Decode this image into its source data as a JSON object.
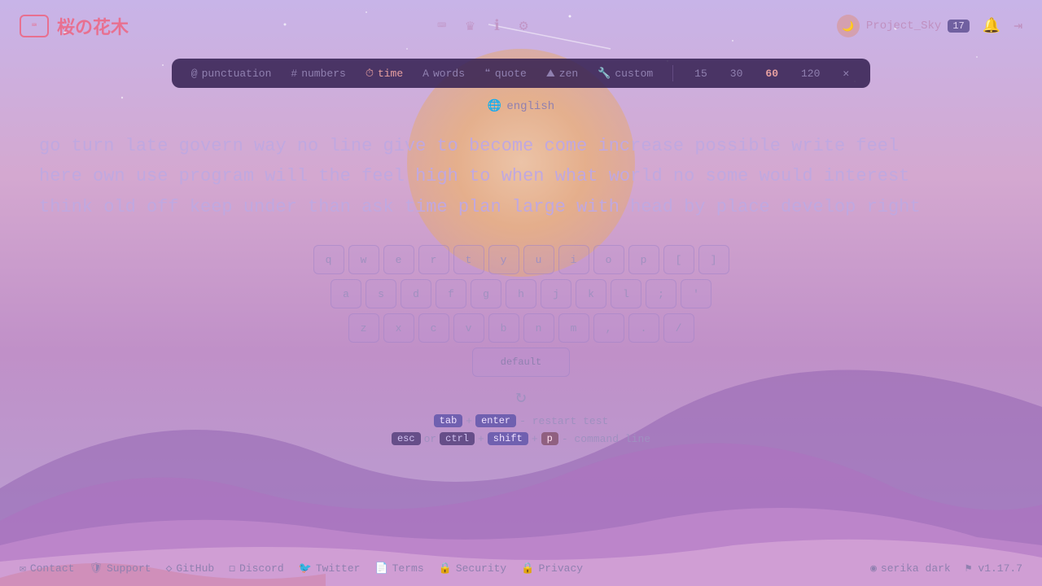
{
  "app": {
    "logo_icon": "⌨",
    "logo_text": "桜の花木",
    "accent_color": "#e87090"
  },
  "header": {
    "nav_icons": [
      "⌨",
      "♛",
      "ℹ",
      "⚙"
    ],
    "user": {
      "name": "Project_Sky",
      "level": "17",
      "avatar_text": "🌙"
    },
    "action_icons": [
      "🔔",
      "→"
    ]
  },
  "toolbar": {
    "items": [
      {
        "id": "punctuation",
        "icon": "@",
        "label": "punctuation",
        "active": false
      },
      {
        "id": "numbers",
        "icon": "#",
        "label": "numbers",
        "active": false
      },
      {
        "id": "time",
        "icon": "⏱",
        "label": "time",
        "active": true
      },
      {
        "id": "words",
        "icon": "A",
        "label": "words",
        "active": false
      },
      {
        "id": "quote",
        "icon": "❝",
        "label": "quote",
        "active": false
      },
      {
        "id": "zen",
        "icon": "⛰",
        "label": "zen",
        "active": false
      },
      {
        "id": "custom",
        "icon": "🔧",
        "label": "custom",
        "active": false
      }
    ],
    "time_options": [
      "15",
      "30",
      "60",
      "120"
    ],
    "active_time": "60",
    "close_icon": "✕"
  },
  "language": {
    "icon": "🌐",
    "label": "english"
  },
  "typing": {
    "line1": "go turn late govern way no line give to become come increase possible write feel",
    "line2": "here own use program will the feel high to when what world no some would interest",
    "line3": "think old off keep under than ask time plan large with head by place develop right"
  },
  "keyboard": {
    "row1": [
      "q",
      "w",
      "e",
      "r",
      "t",
      "y",
      "u",
      "i",
      "o",
      "p",
      "[",
      "]"
    ],
    "row2": [
      "a",
      "s",
      "d",
      "f",
      "g",
      "h",
      "j",
      "k",
      "l",
      ";",
      "'"
    ],
    "row3": [
      "z",
      "x",
      "c",
      "v",
      "b",
      "n",
      "m",
      ",",
      ".",
      "/"
    ],
    "space_label": "default"
  },
  "shortcuts": {
    "restart": {
      "key1": "tab",
      "plus1": "+",
      "key2": "enter",
      "desc": "- restart test"
    },
    "cmdline": {
      "key1": "esc",
      "or": "or",
      "key2": "ctrl",
      "plus1": "+",
      "key3": "shift",
      "plus2": "+",
      "key4": "p",
      "desc": "- command line"
    }
  },
  "footer": {
    "links": [
      {
        "icon": "✉",
        "label": "Contact"
      },
      {
        "icon": "🛡",
        "label": "Support"
      },
      {
        "icon": "◇",
        "label": "GitHub"
      },
      {
        "icon": "□",
        "label": "Discord"
      },
      {
        "icon": "🐦",
        "label": "Twitter"
      },
      {
        "icon": "📄",
        "label": "Terms"
      },
      {
        "icon": "🔒",
        "label": "Security"
      },
      {
        "icon": "🔒",
        "label": "Privacy"
      }
    ],
    "theme": {
      "icon": "◉",
      "label": "serika dark"
    },
    "version": {
      "icon": "⚑",
      "label": "v1.17.7"
    }
  }
}
